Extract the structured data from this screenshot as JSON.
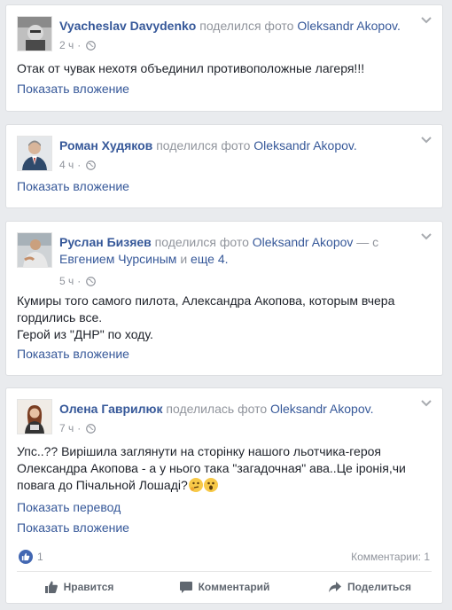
{
  "posts": [
    {
      "author": "Vyacheslav Davydenko",
      "action": "поделился фото",
      "target": "Oleksandr Akopov.",
      "time": "2 ч",
      "text_lines": [
        "Отак от чувак нехотя объединил противоположные лагеря!!!"
      ],
      "attachment_link": "Показать вложение"
    },
    {
      "author": "Роман Худяков",
      "action": "поделился фото",
      "target": "Oleksandr Akopov.",
      "time": "4 ч",
      "text_lines": [],
      "attachment_link": "Показать вложение"
    },
    {
      "author": "Руслан Бизяев",
      "action": "поделился фото",
      "target": "Oleksandr Akopov",
      "with_sep": "— с",
      "with_person": "Евгением Чурсиным",
      "and_text": "и",
      "others": "еще 4.",
      "time": "5 ч",
      "text_lines": [
        "Кумиры того самого пилота, Александра Акопова, которым вчера",
        "гордились все.",
        "Герой из \"ДНР\" по ходу."
      ],
      "attachment_link": "Показать вложение"
    },
    {
      "author": "Олена Гаврилюк",
      "action": "поделилась фото",
      "target": "Oleksandr Akopov.",
      "time": "7 ч",
      "text_lines": [
        "Упс..?? Вирішила заглянути на сторінку нашого льотчика-героя",
        "Олександра Акопова - а у нього така \"загадочная\" ава..Це іронія,чи",
        "повага до Пічальной Лошаді?"
      ],
      "emojis": [
        "thinking-face",
        "surprised-face"
      ],
      "translate_link": "Показать перевод",
      "attachment_link": "Показать вложение",
      "likes_count": "1",
      "comments_count": "Комментарии: 1",
      "actions": {
        "like": "Нравится",
        "comment": "Комментарий",
        "share": "Поделиться"
      }
    }
  ]
}
